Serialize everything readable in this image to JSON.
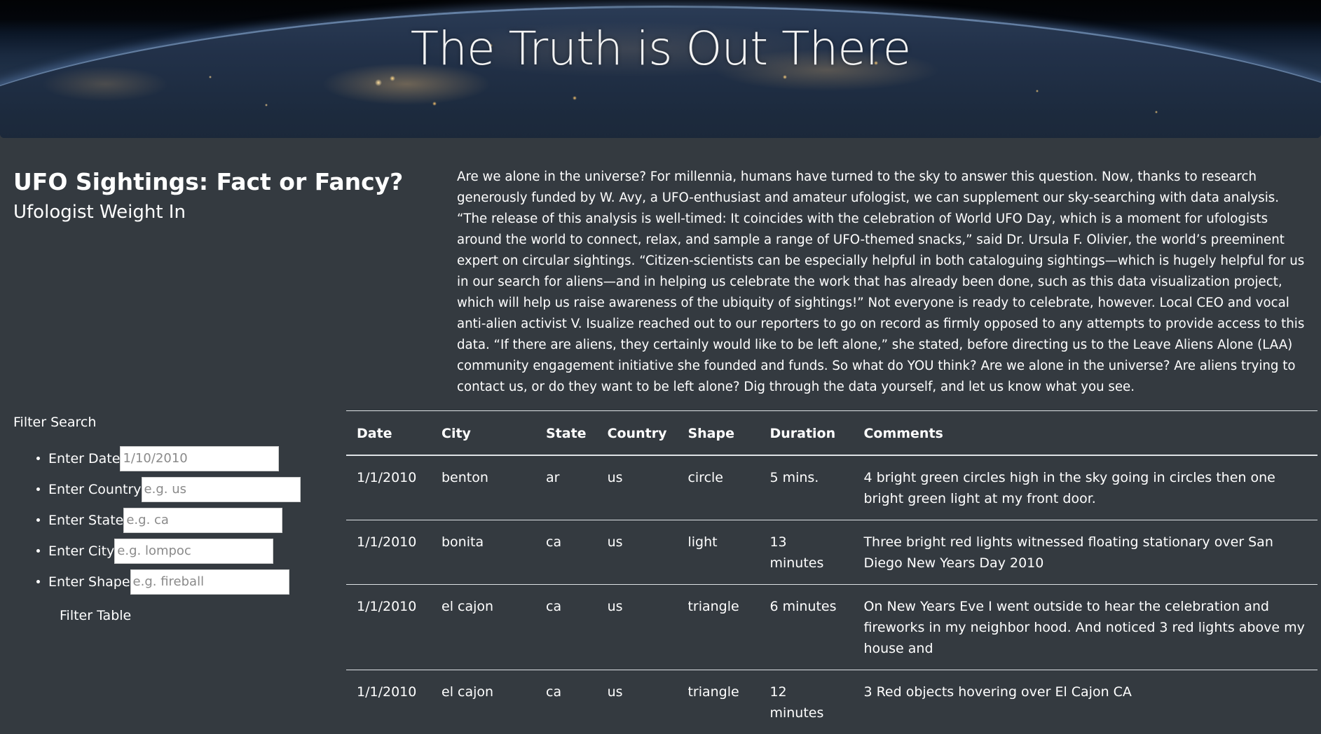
{
  "hero": {
    "title": "The Truth is Out There"
  },
  "sidebar": {
    "title": "UFO Sightings: Fact or Fancy?",
    "subtitle": "Ufologist Weight In"
  },
  "article": {
    "text": "Are we alone in the universe? For millennia, humans have turned to the sky to answer this question. Now, thanks to research generously funded by W. Avy, a UFO-enthusiast and amateur ufologist, we can supplement our sky-searching with data analysis. “The release of this analysis is well-timed: It coincides with the celebration of World UFO Day, which is a moment for ufologists around the world to connect, relax, and sample a range of UFO-themed snacks,” said Dr. Ursula F. Olivier, the world’s preeminent expert on circular sightings. “Citizen-scientists can be especially helpful in both cataloguing sightings—which is hugely helpful for us in our search for aliens—and in helping us celebrate the work that has already been done, such as this data visualization project, which will help us raise awareness of the ubiquity of sightings!” Not everyone is ready to celebrate, however. Local CEO and vocal anti-alien activist V. Isualize reached out to our reporters to go on record as firmly opposed to any attempts to provide access to this data. “If there are aliens, they certainly would like to be left alone,” she stated, before directing us to the Leave Aliens Alone (LAA) community engagement initiative she founded and funds. So what do YOU think? Are we alone in the universe? Are aliens trying to contact us, or do they want to be left alone? Dig through the data yourself, and let us know what you see."
  },
  "filter": {
    "heading": "Filter Search",
    "date_label": "Enter Date",
    "date_placeholder": "1/10/2010",
    "country_label": "Enter Country",
    "country_placeholder": "e.g. us",
    "state_label": "Enter State",
    "state_placeholder": "e.g. ca",
    "city_label": "Enter City",
    "city_placeholder": "e.g. lompoc",
    "shape_label": "Enter Shape",
    "shape_placeholder": "e.g. fireball",
    "button_label": "Filter Table"
  },
  "table": {
    "headers": [
      "Date",
      "City",
      "State",
      "Country",
      "Shape",
      "Duration",
      "Comments"
    ],
    "rows": [
      [
        "1/1/2010",
        "benton",
        "ar",
        "us",
        "circle",
        "5 mins.",
        "4 bright green circles high in the sky going in circles then one bright green light at my front door."
      ],
      [
        "1/1/2010",
        "bonita",
        "ca",
        "us",
        "light",
        "13 minutes",
        "Three bright red lights witnessed floating stationary over San Diego New Years Day 2010"
      ],
      [
        "1/1/2010",
        "el cajon",
        "ca",
        "us",
        "triangle",
        "6 minutes",
        "On New Years Eve I went outside to hear the celebration and fireworks in my neighbor hood. And noticed 3 red lights above my house and"
      ],
      [
        "1/1/2010",
        "el cajon",
        "ca",
        "us",
        "triangle",
        "12 minutes",
        "3 Red objects hovering over El Cajon CA"
      ]
    ]
  }
}
